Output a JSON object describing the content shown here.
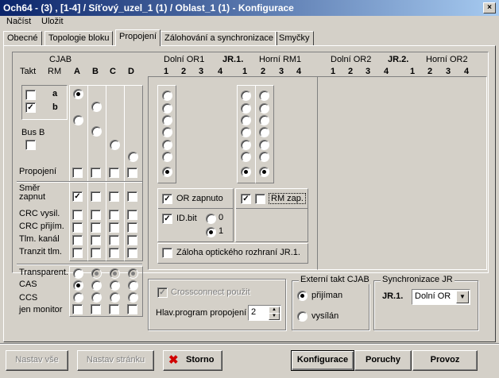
{
  "window": {
    "title": "Och64 - (3) , [1-4] / Síťový_uzel_1 (1) / Oblast_1 (1) - Konfigurace",
    "close": "×"
  },
  "menu": [
    "Načíst",
    "Uložit"
  ],
  "tabs": [
    "Obecné",
    "Topologie bloku",
    "Propojení",
    "Zálohování a synchronizace",
    "Smyčky"
  ],
  "cjab": {
    "title": "CJAB",
    "takt": "Takt",
    "rm": "RM",
    "cols": [
      "A",
      "B",
      "C",
      "D"
    ],
    "row_a": "a",
    "row_b": "b",
    "bus_b": "Bus B",
    "propojeni": "Propojení",
    "smer_zapnut": "Směr zapnut",
    "crc_vysil": "CRC vysil.",
    "crc_prijim": "CRC přijím.",
    "tlm_kanal": "Tlm. kanál",
    "tranzit_tlm": "Tranzit tlm.",
    "transparent": "Transparent.",
    "cas": "CAS",
    "ccs": "CCS",
    "jen_monitor": "jen monitor"
  },
  "jr1": {
    "dolni": "Dolní OR1",
    "title": "JR.1.",
    "horni": "Horní RM1",
    "nums_dolni": [
      "1",
      "2",
      "3",
      "4"
    ],
    "nums_horni": [
      "1",
      "2",
      "3",
      "4"
    ],
    "or_zapnuto": "OR zapnuto",
    "id_bit": "ID.bit",
    "id0": "0",
    "id1": "1",
    "rm_zap": "RM zap.",
    "zaloha": "Záloha optického rozhraní JR.1."
  },
  "jr2": {
    "dolni": "Dolní OR2",
    "title": "JR.2.",
    "horni": "Horní OR2",
    "nums_dolni": [
      "1",
      "2",
      "3",
      "4"
    ],
    "nums_horni": [
      "1",
      "2",
      "3",
      "4"
    ]
  },
  "crossconnect": {
    "label": "Crossconnect použit",
    "program_label": "Hlav.program propojení",
    "program_value": "2"
  },
  "externi": {
    "title": "Externí takt CJAB",
    "prijiman": "přijíman",
    "vysilan": "vysílán"
  },
  "sync": {
    "title": "Synchronizace JR",
    "jr": "JR.1.",
    "value": "Dolní OR"
  },
  "buttons": {
    "nastav_vse": "Nastav vše",
    "nastav_stranku": "Nastav stránku",
    "storno": "Storno",
    "konfigurace": "Konfigurace",
    "poruchy": "Poruchy",
    "provoz": "Provoz"
  },
  "icons": {
    "storno": "red-x-icon",
    "check": "✓",
    "cross": "✖"
  }
}
